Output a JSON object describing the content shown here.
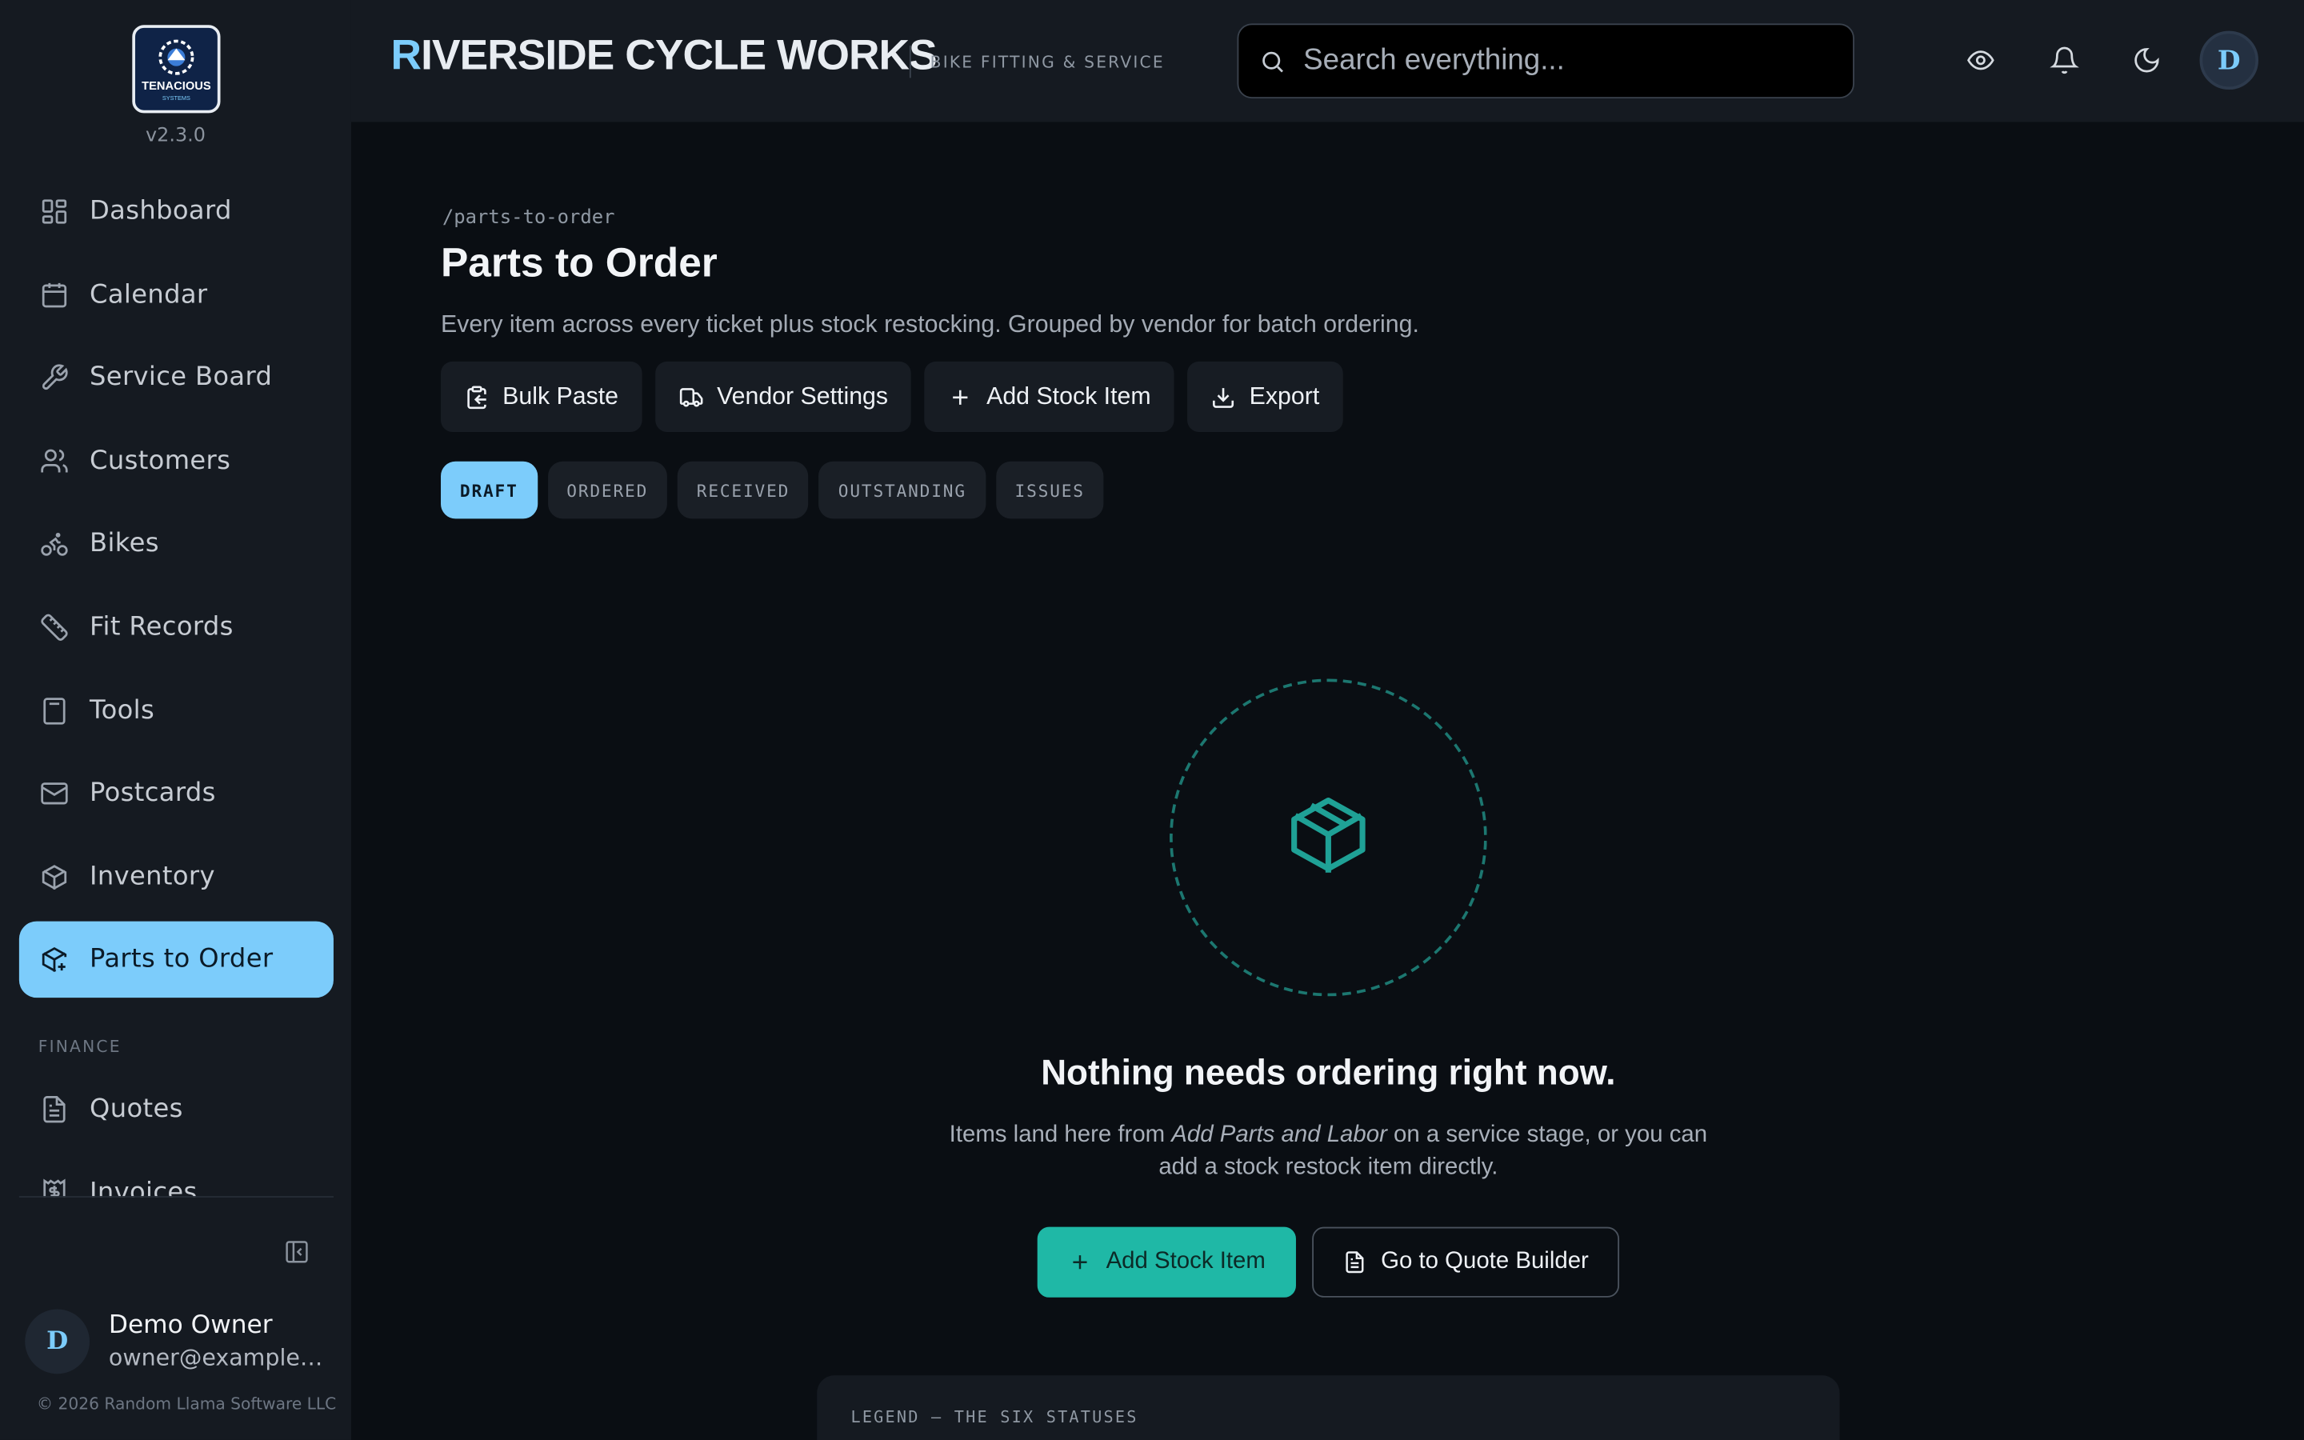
{
  "app": {
    "version": "v2.3.0",
    "brand_first": "R",
    "brand_rest": "IVERSIDE CYCLE WORKS",
    "tagline": "BIKE FITTING & SERVICE",
    "logo_text": "TENACIOUS",
    "logo_sub": "SYSTEMS",
    "colors": {
      "accent": "#7cccfb",
      "teal": "#1fb8a6",
      "bg": "#0a0e13",
      "panel": "#151a21"
    }
  },
  "sidebar": {
    "items": [
      {
        "label": "Dashboard",
        "icon": "dashboard-icon"
      },
      {
        "label": "Calendar",
        "icon": "calendar-icon"
      },
      {
        "label": "Service Board",
        "icon": "wrench-icon"
      },
      {
        "label": "Customers",
        "icon": "users-icon"
      },
      {
        "label": "Bikes",
        "icon": "bike-icon"
      },
      {
        "label": "Fit Records",
        "icon": "ruler-icon"
      },
      {
        "label": "Tools",
        "icon": "calculator-icon"
      },
      {
        "label": "Postcards",
        "icon": "mail-icon"
      },
      {
        "label": "Inventory",
        "icon": "package-icon"
      },
      {
        "label": "Parts to Order",
        "icon": "package-plus-icon",
        "active": true
      }
    ],
    "finance_label": "FINANCE",
    "finance_items": [
      {
        "label": "Quotes",
        "icon": "file-icon"
      },
      {
        "label": "Invoices",
        "icon": "receipt-icon"
      }
    ],
    "user": {
      "initial": "D",
      "name": "Demo Owner",
      "email": "owner@example.com"
    },
    "copyright": "© 2026 Random Llama Software LLC"
  },
  "topbar": {
    "search_placeholder": "Search everything...",
    "avatar_initial": "D"
  },
  "main": {
    "route": "/parts-to-order",
    "title": "Parts to Order",
    "subtitle": "Every item across every ticket plus stock restocking. Grouped by vendor for batch ordering.",
    "actions": [
      {
        "label": "Bulk Paste",
        "icon": "clipboard-icon"
      },
      {
        "label": "Vendor Settings",
        "icon": "truck-icon"
      },
      {
        "label": "Add Stock Item",
        "icon": "plus-icon"
      },
      {
        "label": "Export",
        "icon": "download-icon"
      }
    ],
    "tabs": [
      {
        "label": "DRAFT",
        "active": true
      },
      {
        "label": "ORDERED"
      },
      {
        "label": "RECEIVED"
      },
      {
        "label": "OUTSTANDING"
      },
      {
        "label": "ISSUES"
      }
    ],
    "empty": {
      "title": "Nothing needs ordering right now.",
      "text_before": "Items land here from ",
      "text_em": "Add Parts and Labor",
      "text_after": " on a service stage, or you can add a stock restock item directly.",
      "primary_label": "Add Stock Item",
      "secondary_label": "Go to Quote Builder"
    },
    "legend_title": "LEGEND — THE SIX STATUSES"
  }
}
